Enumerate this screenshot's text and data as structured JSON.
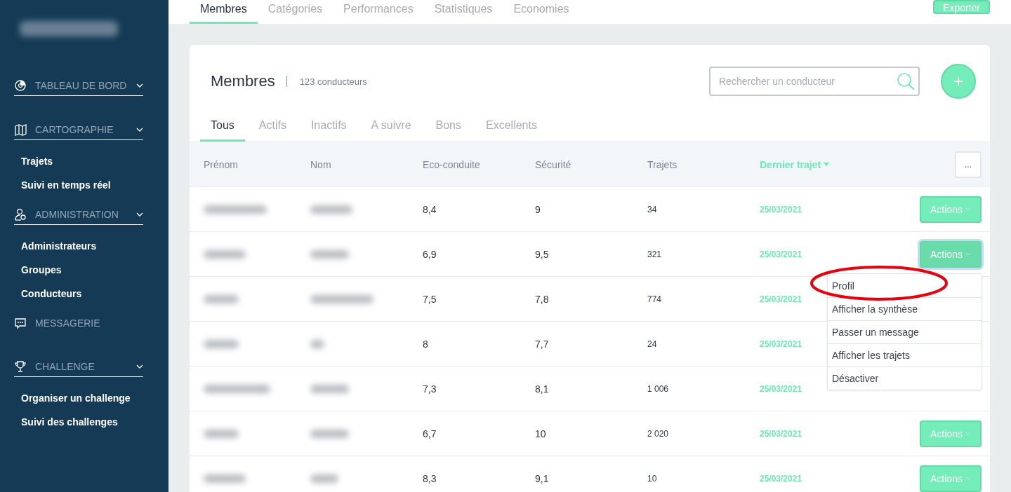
{
  "sidebar": {
    "sections": [
      {
        "label": "TABLEAU DE BORD",
        "expandable": true
      },
      {
        "label": "CARTOGRAPHIE",
        "expandable": true,
        "items": [
          "Trajets",
          "Suivi en temps réel"
        ]
      },
      {
        "label": "ADMINISTRATION",
        "expandable": true,
        "items": [
          "Administrateurs",
          "Groupes",
          "Conducteurs"
        ]
      },
      {
        "label": "MESSAGERIE",
        "expandable": false
      },
      {
        "label": "CHALLENGE",
        "expandable": true,
        "items": [
          "Organiser un challenge",
          "Suivi des challenges"
        ]
      }
    ]
  },
  "top_tabs": [
    {
      "label": "Membres",
      "selected": true
    },
    {
      "label": "Catégories",
      "selected": false
    },
    {
      "label": "Performances",
      "selected": false
    },
    {
      "label": "Statistiques",
      "selected": false
    },
    {
      "label": "Economies",
      "selected": false
    }
  ],
  "export_button": "Exporter",
  "card": {
    "title": "Membres",
    "count": "123 conducteurs",
    "search": {
      "placeholder": "Rechercher un conducteur"
    },
    "add_button": "+",
    "filter_tabs": [
      {
        "label": "Tous",
        "selected": true
      },
      {
        "label": "Actifs",
        "selected": false
      },
      {
        "label": "Inactifs",
        "selected": false
      },
      {
        "label": "A suivre",
        "selected": false
      },
      {
        "label": "Bons",
        "selected": false
      },
      {
        "label": "Excellents",
        "selected": false
      }
    ],
    "table": {
      "columns": [
        {
          "label": "Prénom",
          "sorted": false
        },
        {
          "label": "Nom",
          "sorted": false
        },
        {
          "label": "Eco-conduite",
          "sorted": false
        },
        {
          "label": "Sécurité",
          "sorted": false
        },
        {
          "label": "Trajets",
          "sorted": false
        },
        {
          "label": "Dernier trajet",
          "sorted": true
        }
      ],
      "more_button": "...",
      "rows": [
        {
          "eco": "8,4",
          "securite": "9",
          "trajets": "34",
          "dernier": "25/03/2021",
          "action": "Actions",
          "open": false
        },
        {
          "eco": "6,9",
          "securite": "9,5",
          "trajets": "321",
          "dernier": "25/03/2021",
          "action": "Actions",
          "open": true
        },
        {
          "eco": "7,5",
          "securite": "7,8",
          "trajets": "774",
          "dernier": "25/03/2021"
        },
        {
          "eco": "8",
          "securite": "7,7",
          "trajets": "24",
          "dernier": "25/03/2021"
        },
        {
          "eco": "7,3",
          "securite": "8,1",
          "trajets": "1 006",
          "dernier": "25/03/2021"
        },
        {
          "eco": "6,7",
          "securite": "10",
          "trajets": "2 020",
          "dernier": "25/03/2021",
          "action": "Actions",
          "open": false
        },
        {
          "eco": "8,3",
          "securite": "9,1",
          "trajets": "10",
          "dernier": "25/03/2021",
          "action": "Actions",
          "open": false
        }
      ]
    },
    "action_menu": [
      {
        "label": "Profil",
        "circled": true
      },
      {
        "label": "Afficher la synthèse",
        "circled": false
      },
      {
        "label": "Passer un message",
        "circled": false
      },
      {
        "label": "Afficher les trajets",
        "circled": false
      },
      {
        "label": "Désactiver",
        "circled": false
      }
    ]
  }
}
